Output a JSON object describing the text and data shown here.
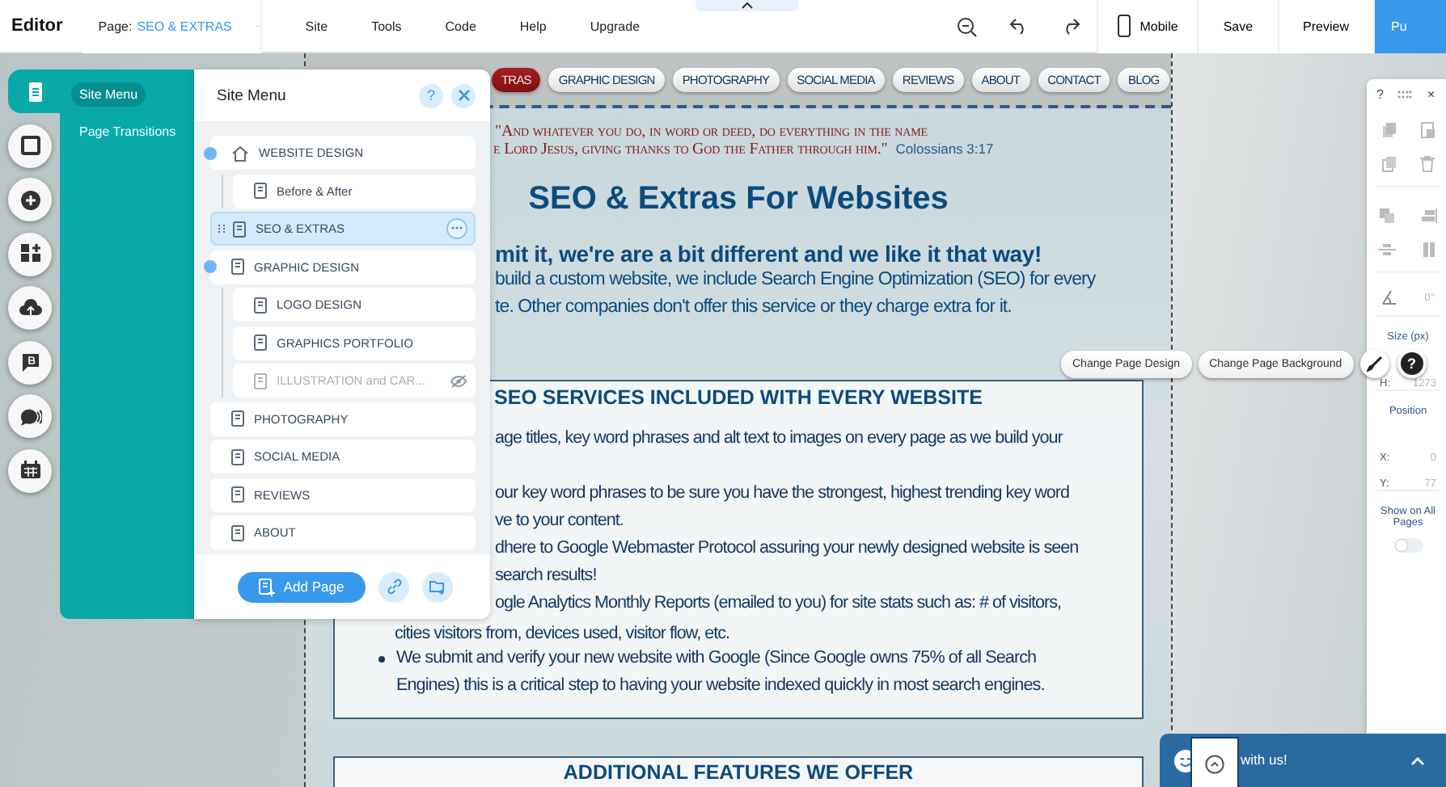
{
  "topbar": {
    "title": "Editor",
    "page_label": "Page:",
    "page_name": "SEO & EXTRAS",
    "menus": [
      "Site",
      "Tools",
      "Code",
      "Help",
      "Upgrade"
    ],
    "mobile": "Mobile",
    "save": "Save",
    "preview": "Preview",
    "publish": "Pu"
  },
  "left_toolbar": [
    {
      "kind": "pages",
      "selected": true
    },
    {
      "kind": "box",
      "selected": false
    },
    {
      "kind": "add",
      "selected": false
    },
    {
      "kind": "apps",
      "selected": false
    },
    {
      "kind": "upload",
      "selected": false
    },
    {
      "kind": "blog",
      "selected": false
    },
    {
      "kind": "chat",
      "selected": false
    },
    {
      "kind": "calendar",
      "selected": false
    }
  ],
  "site_menu": {
    "tabs": [
      {
        "label": "Site Menu",
        "selected": true
      },
      {
        "label": "Page Transitions",
        "selected": false
      }
    ],
    "title": "Site Menu",
    "help": "?",
    "pages": [
      {
        "label": "WEBSITE DESIGN",
        "kind": "home",
        "selected": false,
        "hidden": false,
        "expanded": true,
        "children": [
          {
            "label": "Before & After",
            "kind": "page",
            "selected": false,
            "hidden": false
          }
        ]
      },
      {
        "label": "SEO & EXTRAS",
        "kind": "page",
        "selected": true,
        "hidden": false
      },
      {
        "label": "GRAPHIC DESIGN",
        "kind": "page",
        "selected": false,
        "hidden": false,
        "expanded": true,
        "children": [
          {
            "label": "LOGO DESIGN",
            "kind": "page",
            "selected": false,
            "hidden": false
          },
          {
            "label": "GRAPHICS PORTFOLIO",
            "kind": "page",
            "selected": false,
            "hidden": false
          },
          {
            "label": "ILLUSTRATION and CAR...",
            "kind": "page",
            "selected": false,
            "hidden": true
          }
        ]
      },
      {
        "label": "PHOTOGRAPHY",
        "kind": "page",
        "selected": false,
        "hidden": false
      },
      {
        "label": "SOCIAL MEDIA",
        "kind": "page",
        "selected": false,
        "hidden": false
      },
      {
        "label": "REVIEWS",
        "kind": "page",
        "selected": false,
        "hidden": false
      },
      {
        "label": "ABOUT",
        "kind": "page",
        "selected": false,
        "hidden": false
      }
    ],
    "add_page": "Add Page"
  },
  "site": {
    "nav": [
      {
        "label": "TRAS",
        "selected": true
      },
      {
        "label": "GRAPHIC DESIGN",
        "selected": false
      },
      {
        "label": "PHOTOGRAPHY",
        "selected": false
      },
      {
        "label": "SOCIAL MEDIA",
        "selected": false
      },
      {
        "label": "REVIEWS",
        "selected": false
      },
      {
        "label": "ABOUT",
        "selected": false
      },
      {
        "label": "CONTACT",
        "selected": false
      },
      {
        "label": "BLOG",
        "selected": false
      }
    ],
    "quote_line_1": "\"And whatever you do, in word or deed, do everything in the name",
    "quote_line_2": "e Lord Jesus, giving thanks to God the Father through him.\"",
    "quote_ref": "Colossians 3:17",
    "heading": "SEO & Extras For Websites",
    "subheading": "mit it, we're are a bit different and we like it that way!",
    "intro": [
      "build a custom website, we include Search Engine Optimization (SEO) for every",
      "te.  Other companies don't offer this service or they charge extra for it."
    ],
    "section": {
      "title": "SEO SERVICES INCLUDED WITH EVERY WEBSITE",
      "fragments": [
        "age titles, key word phrases and alt text to images on every page as we build your",
        "our key word phrases to be sure you have the strongest, highest trending key word",
        "ve to your content.",
        "dhere to Google Webmaster Protocol assuring your newly designed website is seen",
        "search results!",
        "ogle Analytics Monthly Reports (emailed to you) for site stats such as: # of visitors,"
      ],
      "bullet_tail": "cities visitors from, devices used, visitor flow, etc.",
      "bullets": [
        "We submit and verify your new website with Google (Since Google owns 75% of all Search Engines) this is a critical step to having your website indexed quickly in most search engines."
      ]
    },
    "section_2_title": "ADDITIONAL FEATURES WE OFFER"
  },
  "floating_buttons": [
    "Change Page Design",
    "Change Page Background"
  ],
  "floating_help": "?",
  "inspector": {
    "help": "?",
    "close": "×",
    "rotation": "0°",
    "size_label": "Size (px)",
    "h_label": "H:",
    "h_value": "1273",
    "position_label": "Position",
    "x_label": "X:",
    "x_value": "0",
    "y_label": "Y:",
    "y_value": "77",
    "show_all_label": "Show on All Pages",
    "show_all_on": false
  },
  "chat": {
    "text": "with us!"
  }
}
